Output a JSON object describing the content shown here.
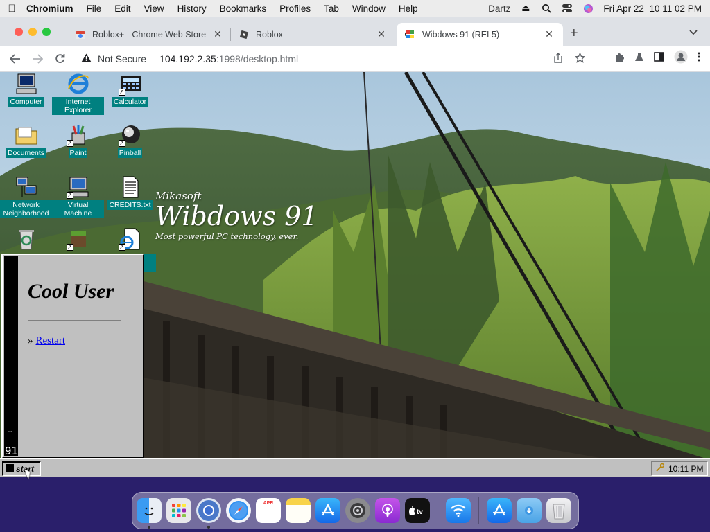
{
  "menubar": {
    "app_name": "Chromium",
    "items": [
      "File",
      "Edit",
      "View",
      "History",
      "Bookmarks",
      "Profiles",
      "Tab",
      "Window",
      "Help"
    ],
    "user": "Dartz",
    "datetime": "Fri Apr 22  10 11 02 PM"
  },
  "tabs": [
    {
      "title": "Roblox+ - Chrome Web Store",
      "icon": "chrome-web-store-icon"
    },
    {
      "title": "Roblox",
      "icon": "roblox-icon"
    },
    {
      "title": "Wibdows 91 (REL5)",
      "icon": "windows-logo-icon",
      "active": true
    }
  ],
  "address_bar": {
    "security_label": "Not Secure",
    "host": "104.192.2.35",
    "path": ":1998/desktop.html"
  },
  "desktop": {
    "icons": [
      {
        "label": "Computer",
        "icon": "computer-icon"
      },
      {
        "label": "Internet Explorer",
        "icon": "internet-explorer-icon"
      },
      {
        "label": "Calculator",
        "icon": "calculator-icon"
      },
      {
        "label": "Documents",
        "icon": "documents-folder-icon"
      },
      {
        "label": "Paint",
        "icon": "paint-icon"
      },
      {
        "label": "Pinball",
        "icon": "pinball-icon"
      },
      {
        "label": "Network Neighborhood",
        "icon": "network-icon"
      },
      {
        "label": "Virtual Machine",
        "icon": "virtual-machine-icon"
      },
      {
        "label": "CREDITS.txt",
        "icon": "text-file-icon"
      },
      {
        "label": "",
        "icon": "recycle-bin-icon"
      },
      {
        "label": "",
        "icon": "minecraft-icon"
      },
      {
        "label": "",
        "icon": "html-document-icon"
      }
    ],
    "brand": {
      "maker": "Mikasoft",
      "product": "Wibdows 91",
      "tagline": "Most powerful PC technology, ever."
    }
  },
  "start_menu": {
    "username": "Cool User",
    "link_bullet": "»",
    "link_label": "Restart",
    "sidebar_text": "91",
    "sidebar_smile": "⌣"
  },
  "taskbar": {
    "start_label": "start",
    "clock": "10:11 PM"
  },
  "dock": {
    "calendar_month": "APR",
    "calendar_day": "22",
    "apps": [
      "Finder",
      "Launchpad",
      "Chromium",
      "Safari",
      "Calendar",
      "Notes",
      "App Store",
      "System Preferences",
      "Podcasts",
      "TV",
      "Wi-Fi",
      "App Store",
      "Downloads",
      "Trash"
    ]
  }
}
